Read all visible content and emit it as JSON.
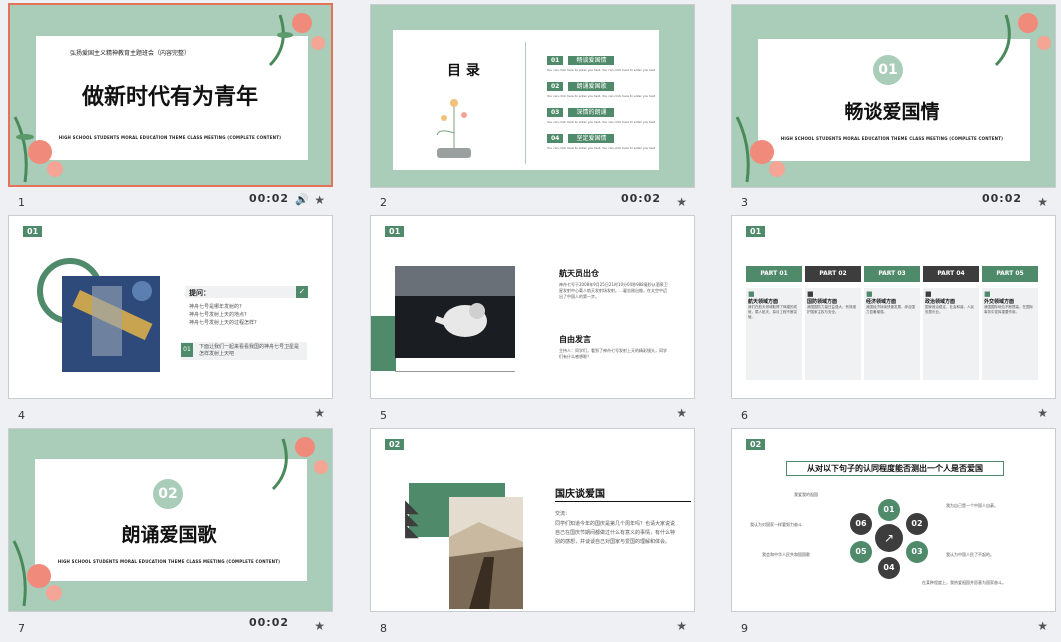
{
  "slides": [
    {
      "num": "1",
      "time": "00:02",
      "title": "做新时代有为青年",
      "top_text": "弘扬爱国主义精神教育主题班会（内容完整）",
      "sub": "HIGH SCHOOL STUDENTS MORAL EDUCATION THEME CLASS MEETING (COMPLETE CONTENT)"
    },
    {
      "num": "2",
      "time": "00:02",
      "title": "目 录",
      "items": [
        {
          "n": "01",
          "t": "畅谈爱国情"
        },
        {
          "n": "02",
          "t": "朗诵爱国歌"
        },
        {
          "n": "03",
          "t": "深情的朗诵"
        },
        {
          "n": "04",
          "t": "坚定爱国情"
        }
      ],
      "item_sub": "You can click here to enter you text. You can click here to enter you text"
    },
    {
      "num": "3",
      "time": "00:02",
      "badge": "01",
      "title": "畅谈爱国情",
      "sub": "HIGH SCHOOL STUDENTS MORAL EDUCATION THEME CLASS MEETING (COMPLETE CONTENT)"
    },
    {
      "num": "4",
      "badge": "01",
      "q_title": "提问：",
      "q_lines": [
        "神舟七号是哪年发射的?",
        "神舟七号发射上天的地点?",
        "神舟七号发射上天的过程怎样?"
      ],
      "step": "01",
      "step_text": "下面让我们一起来看看我国的神舟七号卫星是怎样发射上天吧"
    },
    {
      "num": "5",
      "badge": "01",
      "h1": "航天员出仓",
      "p1": "神舟七号于2008年9月25日21时10分04秒988毫秒从酒泉卫星发射中心载人航天发射场发射。…翟志刚出舱，在太空中迈出了中国人的第一步。",
      "h2": "自由发言",
      "p2": "主持人：同学们，看到了神舟七号发射上天的精彩镜头，同学们有什么感想呢？"
    },
    {
      "num": "6",
      "badge": "01",
      "parts": [
        {
          "p": "PART 01",
          "h": "航天领域方面",
          "t": "我们在航天领域取得了辉煌的成就，载人航天、探月工程不断突破。"
        },
        {
          "p": "PART 02",
          "h": "国防领域方面",
          "t": "我国国防力量日益强大，有效维护国家主权与安全。"
        },
        {
          "p": "PART 03",
          "h": "经济领域方面",
          "t": "我国经济持续快速发展，综合国力显著增强。"
        },
        {
          "p": "PART 04",
          "h": "政治领域方面",
          "t": "国家政治稳定，社会和谐，人民安居乐业。"
        },
        {
          "p": "PART 05",
          "h": "外交领域方面",
          "t": "我国国际地位不断提高，在国际事务中发挥重要作用。"
        }
      ]
    },
    {
      "num": "7",
      "time": "00:02",
      "badge": "02",
      "title": "朗诵爱国歌",
      "sub": "HIGH SCHOOL STUDENTS MORAL EDUCATION THEME CLASS MEETING (COMPLETE CONTENT)"
    },
    {
      "num": "8",
      "badge": "02",
      "h": "国庆谈爱国",
      "body_title": "交流：",
      "body": "同学们知道今年的国庆是第几个周年吗？也请大家说说自己在国庆节期间都做过什么有意义的事情，有什么特别的感想，并谈谈自己对国家与爱国的理解和体会。"
    },
    {
      "num": "9",
      "badge": "02",
      "title": "从对以下句子的认同程度能否测出一个人是否爱国",
      "nodes": [
        "01",
        "02",
        "03",
        "04",
        "05",
        "06"
      ],
      "left_texts": [
        "我爱我的祖国",
        "我认为对国家一样要努力奋斗",
        "我会和中华人民共和国国歌"
      ],
      "right_texts": [
        "我为自己是一个中国人自豪。",
        "我认为中国人民了不起的。",
        "在某种程度上，我热爱祖国并愿意为国家奋斗。"
      ]
    }
  ],
  "colors": {
    "green": "#4f8a6a",
    "mint": "#a9cdb8",
    "dark": "#3d3d3d",
    "select": "#e5735a"
  }
}
